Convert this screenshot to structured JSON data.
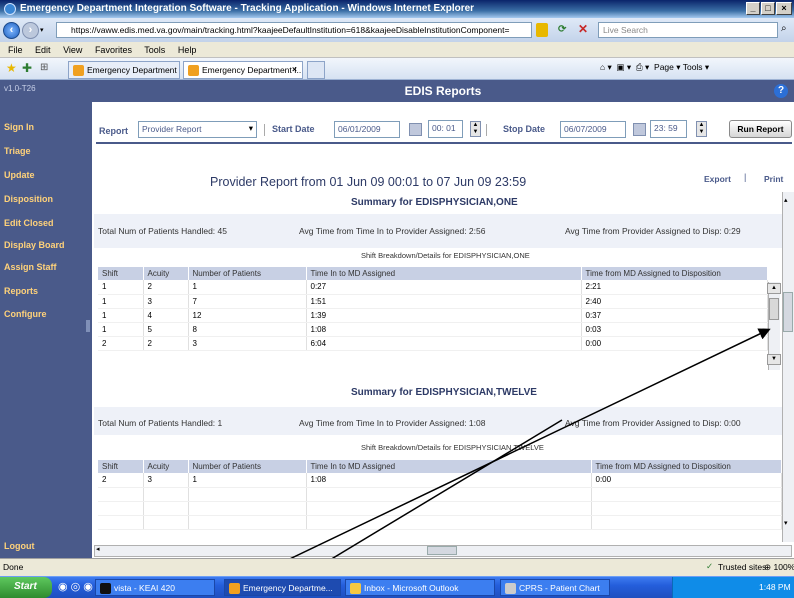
{
  "window": {
    "title": "Emergency Department Integration Software - Tracking Application - Windows Internet Explorer"
  },
  "browser": {
    "address": "https://vaww.edis.med.va.gov/main/tracking.html?kaajeeDefaultInstitution=618&kaajeeDisableInstitutionComponent=",
    "search_placeholder": "Live Search",
    "menu": [
      "File",
      "Edit",
      "View",
      "Favorites",
      "Tools",
      "Help"
    ],
    "tabs": [
      "Emergency Department Inte...",
      "Emergency Department I..."
    ],
    "tools": "Page ▾   Tools ▾"
  },
  "app": {
    "version": "v1.0-T26",
    "header": "EDIS Reports",
    "nav": [
      "Sign In",
      "Triage",
      "Update",
      "Disposition",
      "Edit Closed",
      "Display Board",
      "Assign Staff",
      "Reports",
      "Configure"
    ],
    "logout": "Logout"
  },
  "criteria": {
    "report_label": "Report",
    "report_value": "Provider Report",
    "start_label": "Start Date",
    "start_date": "06/01/2009",
    "start_time": "00: 01",
    "stop_label": "Stop Date",
    "stop_date": "06/07/2009",
    "stop_time": "23: 59",
    "run_button": "Run Report"
  },
  "report": {
    "title": "Provider Report from 01 Jun 09 00:01 to 07 Jun 09 23:59",
    "export": "Export",
    "separator": "|",
    "print": "Print",
    "columns": [
      "Shift",
      "Acuity",
      "Number of Patients",
      "Time In to MD Assigned",
      "Time from MD Assigned to Disposition"
    ],
    "summaries": [
      {
        "title": "Summary for EDISPHYSICIAN,ONE",
        "total": "Total Num of Patients Handled:   45",
        "avg1": "Avg Time from Time In to Provider Assigned:   2:56",
        "avg2": "Avg Time from Provider Assigned to Disp:   0:29",
        "shift_label": "Shift Breakdown/Details for EDISPHYSICIAN,ONE",
        "rows": [
          [
            "1",
            "2",
            "1",
            "0:27",
            "2:21"
          ],
          [
            "1",
            "3",
            "7",
            "1:51",
            "2:40"
          ],
          [
            "1",
            "4",
            "12",
            "1:39",
            "0:37"
          ],
          [
            "1",
            "5",
            "8",
            "1:08",
            "0:03"
          ],
          [
            "2",
            "2",
            "3",
            "6:04",
            "0:00"
          ]
        ]
      },
      {
        "title": "Summary for EDISPHYSICIAN,TWELVE",
        "total": "Total Num of Patients Handled:   1",
        "avg1": "Avg Time from Time In to Provider Assigned:   1:08",
        "avg2": "Avg Time from Provider Assigned to Disp:   0:00",
        "shift_label": "Shift Breakdown/Details for EDISPHYSICIAN,TWELVE",
        "rows": [
          [
            "2",
            "3",
            "1",
            "1:08",
            "0:00"
          ]
        ]
      }
    ]
  },
  "status": {
    "left": "Done",
    "zone": "Trusted sites",
    "zoom": "100%"
  },
  "taskbar": {
    "start": "Start",
    "tasks": [
      "vista - KEAI 420",
      "Emergency Departme...",
      "Inbox - Microsoft Outlook",
      "CPRS - Patient Chart"
    ],
    "clock": "1:48 PM"
  },
  "colors": {
    "app_primary": "#4a5a8a",
    "nav_link": "#ffd27a",
    "table_header": "#c8d0e4"
  }
}
